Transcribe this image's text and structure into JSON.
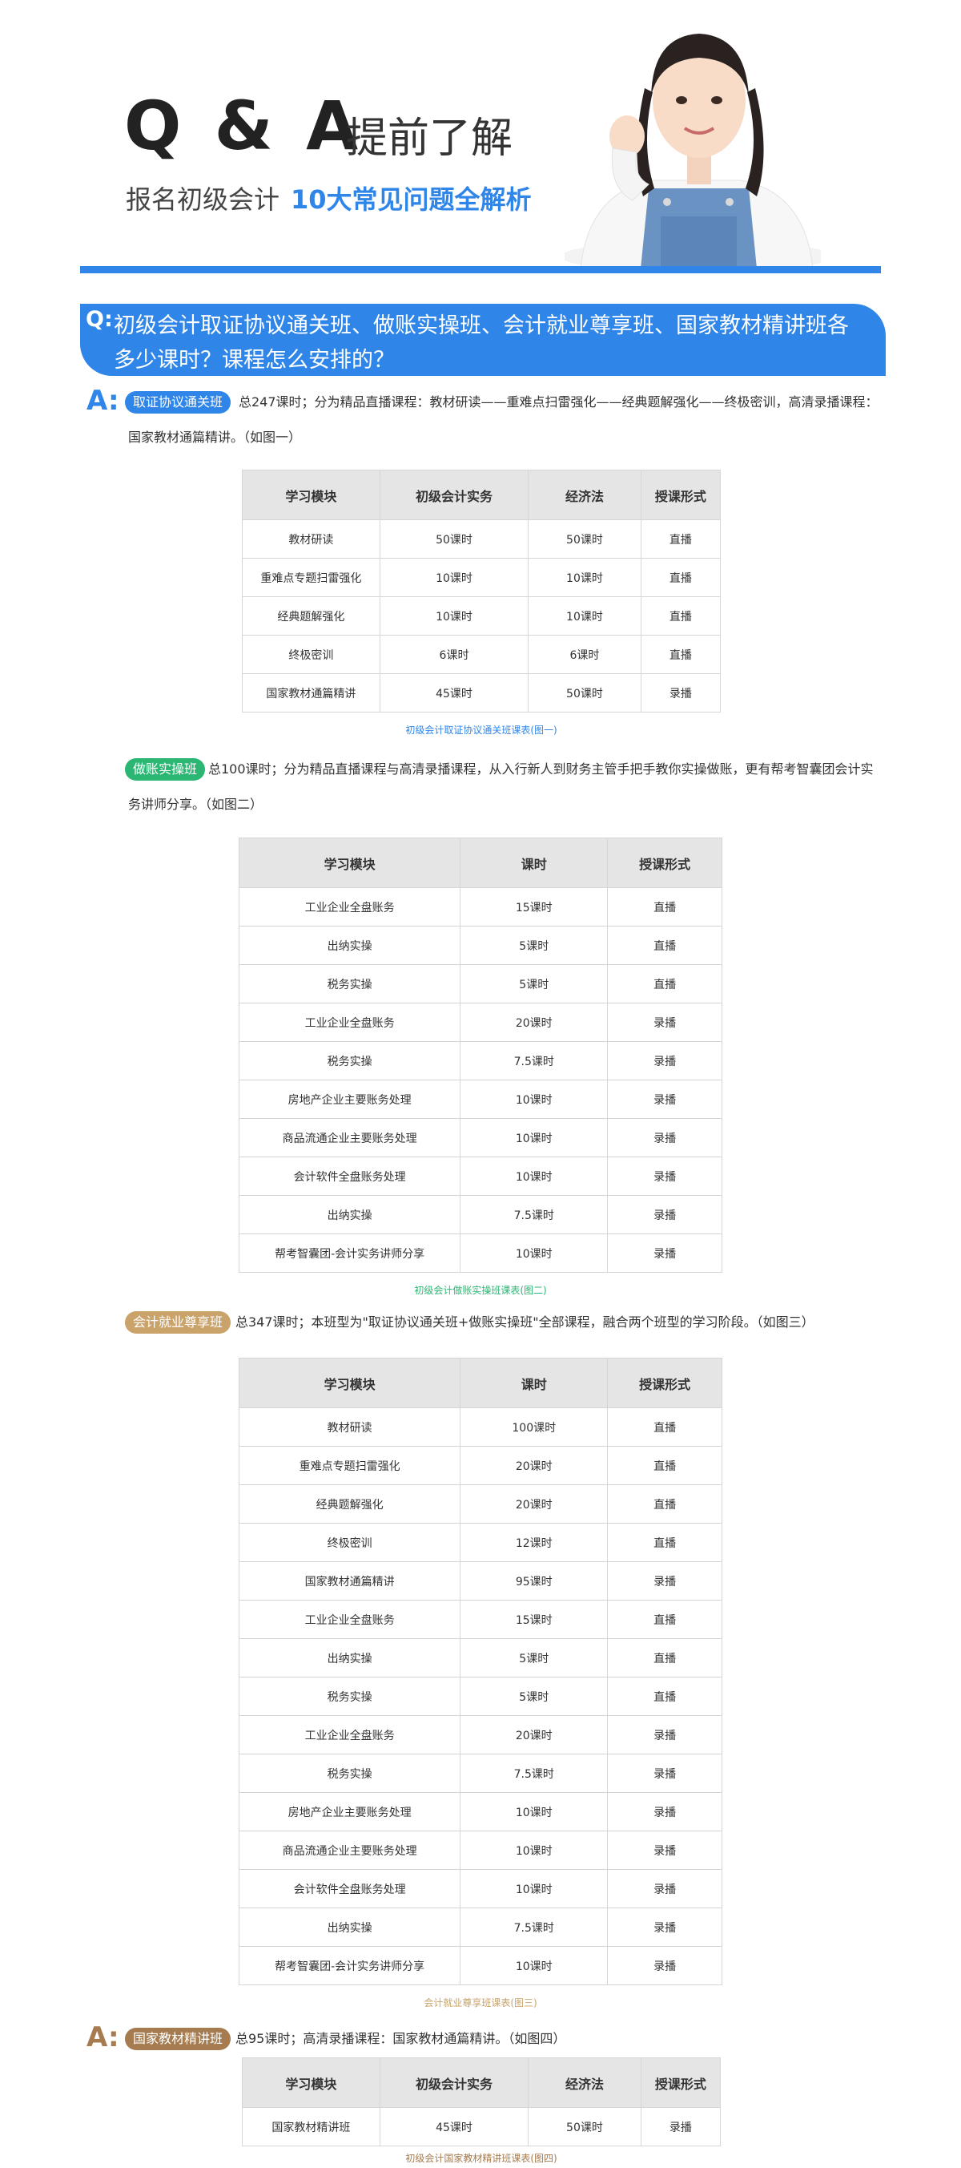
{
  "header": {
    "title": "Q & A",
    "subtitle": "提前了解",
    "line_prefix": "报名初级会计",
    "line_highlight": "10大常见问题全解析"
  },
  "question": {
    "label": "Q:",
    "text": "初级会计取证协议通关班、做账实操班、会计就业尊享班、国家教材精讲班各多少课时？课程怎么安排的？"
  },
  "answer_label": "A:",
  "sections": [
    {
      "tag": "取证协议通关班",
      "tag_color": "#2f86e8",
      "desc": "总247课时；分为精品直播课程：教材研读——重难点扫雷强化——经典题解强化——终极密训，高清录播课程：国家教材通篇精讲。（如图一）",
      "headers": [
        "学习模块",
        "初级会计实务",
        "经济法",
        "授课形式"
      ],
      "rows": [
        [
          "教材研读",
          "50课时",
          "50课时",
          "直播"
        ],
        [
          "重难点专题扫雷强化",
          "10课时",
          "10课时",
          "直播"
        ],
        [
          "经典题解强化",
          "10课时",
          "10课时",
          "直播"
        ],
        [
          "终极密训",
          "6课时",
          "6课时",
          "直播"
        ],
        [
          "国家教材通篇精讲",
          "45课时",
          "50课时",
          "录播"
        ]
      ],
      "caption": "初级会计取证协议通关班课表(图一)",
      "caption_color": "#2f86e8"
    },
    {
      "tag": "做账实操班",
      "tag_color": "#2bb673",
      "desc": "总100课时；分为精品直播课程与高清录播课程，从入行新人到财务主管手把手教你实操做账，更有帮考智囊团会计实务讲师分享。（如图二）",
      "headers": [
        "学习模块",
        "课时",
        "授课形式"
      ],
      "rows": [
        [
          "工业企业全盘账务",
          "15课时",
          "直播"
        ],
        [
          "出纳实操",
          "5课时",
          "直播"
        ],
        [
          "税务实操",
          "5课时",
          "直播"
        ],
        [
          "工业企业全盘账务",
          "20课时",
          "录播"
        ],
        [
          "税务实操",
          "7.5课时",
          "录播"
        ],
        [
          "房地产企业主要账务处理",
          "10课时",
          "录播"
        ],
        [
          "商品流通企业主要账务处理",
          "10课时",
          "录播"
        ],
        [
          "会计软件全盘账务处理",
          "10课时",
          "录播"
        ],
        [
          "出纳实操",
          "7.5课时",
          "录播"
        ],
        [
          "帮考智囊团-会计实务讲师分享",
          "10课时",
          "录播"
        ]
      ],
      "caption": "初级会计做账实操班课表(图二)",
      "caption_color": "#2bb673"
    },
    {
      "tag": "会计就业尊享班",
      "tag_color": "#c9a36a",
      "desc": "总347课时；本班型为\"取证协议通关班+做账实操班\"全部课程，融合两个班型的学习阶段。（如图三）",
      "headers": [
        "学习模块",
        "课时",
        "授课形式"
      ],
      "rows": [
        [
          "教材研读",
          "100课时",
          "直播"
        ],
        [
          "重难点专题扫雷强化",
          "20课时",
          "直播"
        ],
        [
          "经典题解强化",
          "20课时",
          "直播"
        ],
        [
          "终极密训",
          "12课时",
          "直播"
        ],
        [
          "国家教材通篇精讲",
          "95课时",
          "录播"
        ],
        [
          "工业企业全盘账务",
          "15课时",
          "直播"
        ],
        [
          "出纳实操",
          "5课时",
          "直播"
        ],
        [
          "税务实操",
          "5课时",
          "直播"
        ],
        [
          "工业企业全盘账务",
          "20课时",
          "录播"
        ],
        [
          "税务实操",
          "7.5课时",
          "录播"
        ],
        [
          "房地产企业主要账务处理",
          "10课时",
          "录播"
        ],
        [
          "商品流通企业主要账务处理",
          "10课时",
          "录播"
        ],
        [
          "会计软件全盘账务处理",
          "10课时",
          "录播"
        ],
        [
          "出纳实操",
          "7.5课时",
          "录播"
        ],
        [
          "帮考智囊团-会计实务讲师分享",
          "10课时",
          "录播"
        ]
      ],
      "caption": "会计就业尊享班课表(图三)",
      "caption_color": "#c9a36a"
    },
    {
      "tag": "国家教材精讲班",
      "tag_color": "#a57b4f",
      "desc": "总95课时；高清录播课程：国家教材通篇精讲。（如图四）",
      "headers": [
        "学习模块",
        "初级会计实务",
        "经济法",
        "授课形式"
      ],
      "rows": [
        [
          "国家教材精讲班",
          "45课时",
          "50课时",
          "录播"
        ]
      ],
      "caption": "初级会计国家教材精讲班课表(图四)",
      "caption_color": "#a57b4f"
    }
  ],
  "colors": {
    "accent_blue": "#2f86e8",
    "header_gray": "#e5e5e5"
  }
}
